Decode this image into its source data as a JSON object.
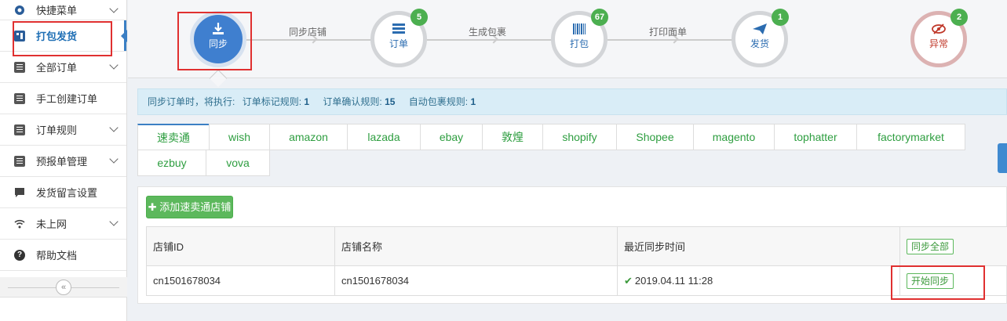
{
  "sidebar": {
    "items": [
      {
        "label": "快捷菜单",
        "icon": "gear-icon",
        "chevron": true
      },
      {
        "label": "打包发货",
        "icon": "package-icon",
        "chevron": false,
        "active": true
      },
      {
        "label": "全部订单",
        "icon": "clipboard-icon",
        "chevron": true
      },
      {
        "label": "手工创建订单",
        "icon": "edit-doc-icon",
        "chevron": false
      },
      {
        "label": "订单规则",
        "icon": "rules-doc-icon",
        "chevron": true
      },
      {
        "label": "预报单管理",
        "icon": "report-doc-icon",
        "chevron": true
      },
      {
        "label": "发货留言设置",
        "icon": "message-icon",
        "chevron": false
      },
      {
        "label": "未上网",
        "icon": "wifi-icon",
        "chevron": true
      },
      {
        "label": "帮助文档",
        "icon": "question-icon",
        "chevron": false
      }
    ],
    "collapse_label": "«"
  },
  "flow": {
    "nodes": [
      {
        "label": "同步",
        "icon": "download-icon",
        "badge": ""
      },
      {
        "label": "订单",
        "icon": "list-icon",
        "badge": "5"
      },
      {
        "label": "打包",
        "icon": "barcode-icon",
        "badge": "67"
      },
      {
        "label": "发货",
        "icon": "paper-plane-icon",
        "badge": "1"
      },
      {
        "label": "异常",
        "icon": "eye-slash-icon",
        "badge": "2"
      }
    ],
    "connectors": [
      "同步店铺",
      "生成包裹",
      "打印面单"
    ]
  },
  "info": {
    "prefix": "同步订单时，将执行:",
    "rule1_label": "订单标记规则:",
    "rule1_count": "1",
    "rule2_label": "订单确认规则:",
    "rule2_count": "15",
    "rule3_label": "自动包裹规则:",
    "rule3_count": "1"
  },
  "tabs": [
    "速卖通",
    "wish",
    "amazon",
    "lazada",
    "ebay",
    "敦煌",
    "shopify",
    "Shopee",
    "magento",
    "tophatter",
    "factorymarket",
    "ezbuy",
    "vova"
  ],
  "panel": {
    "add_button": "添加速卖通店铺",
    "columns": [
      "店铺ID",
      "店铺名称",
      "最近同步时间"
    ],
    "sync_all_button": "同步全部",
    "rows": [
      {
        "id": "cn1501678034",
        "name": "cn1501678034",
        "last_sync": "2019.04.11 11:28",
        "action": "开始同步"
      }
    ]
  },
  "colors": {
    "accent": "#3f7fcf",
    "success": "#5cb85c",
    "highlight_box": "#e03030"
  }
}
